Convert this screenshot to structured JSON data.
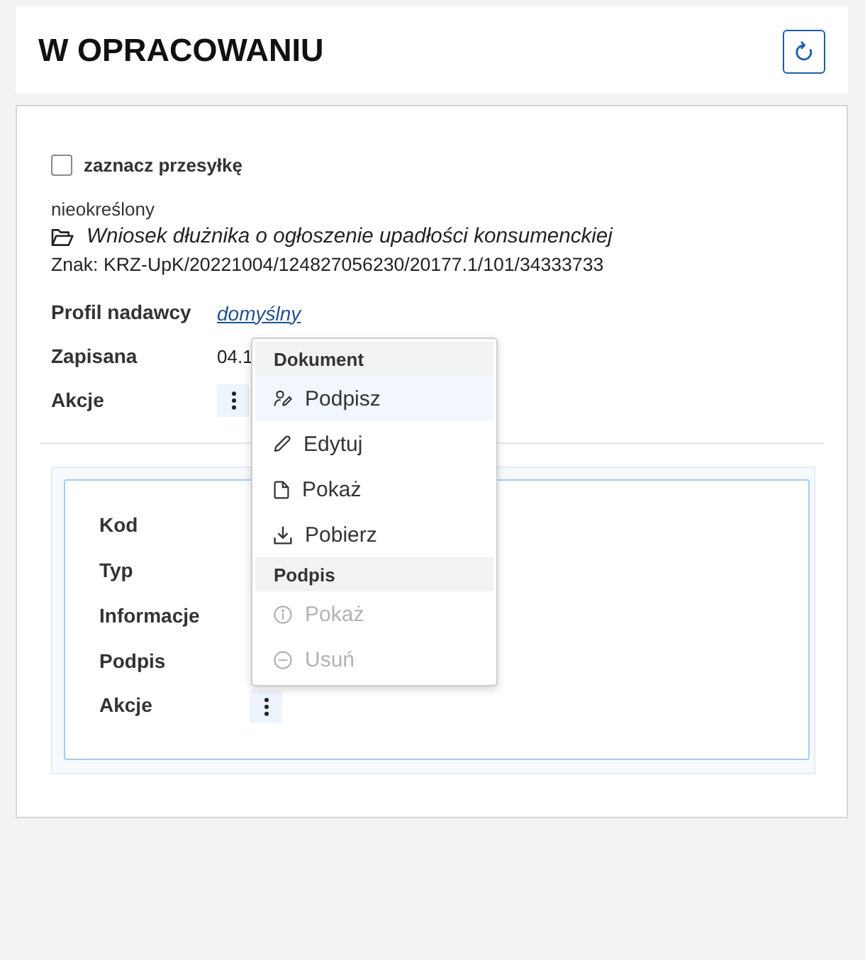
{
  "header": {
    "title": "W OPRACOWANIU"
  },
  "shipment": {
    "select": {
      "label": "zaznacz przesyłkę",
      "checked": false
    },
    "category": "nieokreślony",
    "document_title": "Wniosek dłużnika o ogłoszenie upadłości konsumenckiej",
    "reference": "Znak: KRZ-UpK/20221004/124827056230/20177.1/101/34333733",
    "fields": [
      {
        "label": "Profil nadawcy",
        "kind": "link",
        "value": "domyślny"
      },
      {
        "label": "Zapisana",
        "kind": "text",
        "value": "04.1"
      },
      {
        "label": "Akcje",
        "kind": "actions"
      }
    ]
  },
  "attachment": {
    "fields": [
      {
        "label": "Kod",
        "kind": "empty"
      },
      {
        "label": "Typ",
        "kind": "empty"
      },
      {
        "label": "Informacje",
        "kind": "empty"
      },
      {
        "label": "Podpis",
        "kind": "empty"
      },
      {
        "label": "Akcje",
        "kind": "actions"
      }
    ]
  },
  "actions_menu": {
    "sections": [
      {
        "heading": "Dokument",
        "items": [
          {
            "label": "Podpisz",
            "kind": "sign",
            "highlighted": true,
            "disabled": false
          },
          {
            "label": "Edytuj",
            "kind": "edit",
            "highlighted": false,
            "disabled": false
          },
          {
            "label": "Pokaż",
            "kind": "preview",
            "highlighted": false,
            "disabled": false
          },
          {
            "label": "Pobierz",
            "kind": "download",
            "highlighted": false,
            "disabled": false
          }
        ]
      },
      {
        "heading": "Podpis",
        "items": [
          {
            "label": "Pokaż",
            "kind": "details",
            "highlighted": false,
            "disabled": true
          },
          {
            "label": "Usuń",
            "kind": "remove",
            "highlighted": false,
            "disabled": true
          }
        ]
      }
    ]
  }
}
